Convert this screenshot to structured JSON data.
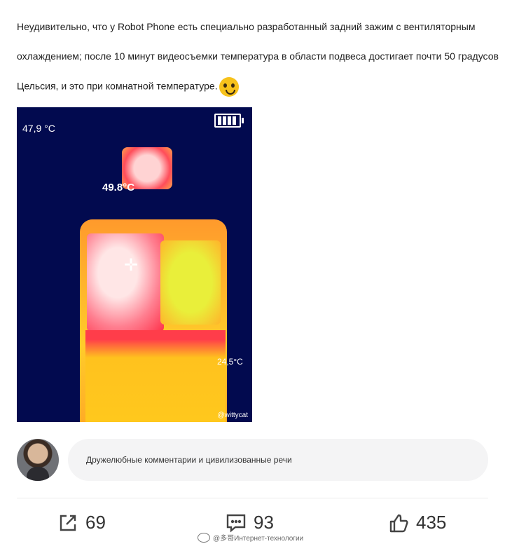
{
  "article": {
    "line1": "Неудивительно, что у Robot Phone есть специально разработанный задний зажим с вентиляторным",
    "line2": "охлаждением; после 10 минут видеосъемки температура в области подвеса достигает почти 50 градусов",
    "line3": "Цельсия, и это при комнатной температуре."
  },
  "thermal_image": {
    "max_temp": "47,9 °C",
    "spot_temp": "49.8°C",
    "ambient_temp": "24,5°C",
    "watermark": "@wittycat"
  },
  "comment": {
    "placeholder": "Дружелюбные комментарии и цивилизованные речи"
  },
  "actions": {
    "share_count": "69",
    "comments_count": "93",
    "likes_count": "435"
  },
  "footer_watermark": "@多哥Интернет-технологии"
}
